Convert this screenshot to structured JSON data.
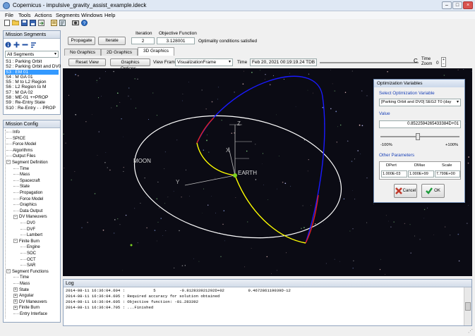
{
  "window": {
    "title": "Copernicus - impulsive_gravity_assist_example.ideck",
    "min": "–",
    "max": "□",
    "close": "×"
  },
  "menu": [
    "File",
    "Tools",
    "Actions",
    "Segments",
    "Windows",
    "Help"
  ],
  "toolbar": {
    "icons": [
      "new-file-icon",
      "open-folder-icon",
      "save-icon",
      "save-as-icon",
      "export-icon",
      "settings-icon",
      "script-icon",
      "render-icon",
      "help-icon"
    ]
  },
  "mission_segments": {
    "title": "Mission Segments",
    "filter": "All Segments",
    "items": [
      "S1 : Parking Orbit",
      "S2 : Parking Orbit and DV0",
      "S3 : EM 01",
      "S4 : M GA 01",
      "S5 : M to L2 Region",
      "S6 : L2 Region to M",
      "S7 : M GA 02",
      "S8 : ME-01 ++PROP",
      "S9 : Re-Entry State",
      "S10 : Re-Entry - - PROP"
    ],
    "selected_index": 2
  },
  "mission_config": {
    "title": "Mission Config",
    "tree": [
      {
        "label": "Info",
        "level": 0,
        "expander": ""
      },
      {
        "label": "SPICE",
        "level": 0,
        "expander": ""
      },
      {
        "label": "Force Model",
        "level": 0,
        "expander": ""
      },
      {
        "label": "Algorithms",
        "level": 0,
        "expander": ""
      },
      {
        "label": "Output Files",
        "level": 0,
        "expander": ""
      },
      {
        "label": "Segment Definition",
        "level": 0,
        "expander": "−"
      },
      {
        "label": "Time",
        "level": 1,
        "expander": ""
      },
      {
        "label": "Mass",
        "level": 1,
        "expander": ""
      },
      {
        "label": "Spacecraft",
        "level": 1,
        "expander": ""
      },
      {
        "label": "State",
        "level": 1,
        "expander": ""
      },
      {
        "label": "Propagation",
        "level": 1,
        "expander": ""
      },
      {
        "label": "Force Model",
        "level": 1,
        "expander": ""
      },
      {
        "label": "Graphics",
        "level": 1,
        "expander": ""
      },
      {
        "label": "Data Output",
        "level": 1,
        "expander": ""
      },
      {
        "label": "DV Maneuvers",
        "level": 1,
        "expander": "−"
      },
      {
        "label": "DV0",
        "level": 2,
        "expander": ""
      },
      {
        "label": "DVF",
        "level": 2,
        "expander": ""
      },
      {
        "label": "Lambert",
        "level": 2,
        "expander": ""
      },
      {
        "label": "Finite Burn",
        "level": 1,
        "expander": "−"
      },
      {
        "label": "Engine",
        "level": 2,
        "expander": ""
      },
      {
        "label": "SOC",
        "level": 2,
        "expander": ""
      },
      {
        "label": "OCT",
        "level": 2,
        "expander": ""
      },
      {
        "label": "SAR",
        "level": 2,
        "expander": ""
      },
      {
        "label": "Segment Functions",
        "level": 0,
        "expander": "−"
      },
      {
        "label": "Time",
        "level": 1,
        "expander": ""
      },
      {
        "label": "Mass",
        "level": 1,
        "expander": ""
      },
      {
        "label": "State",
        "level": 1,
        "expander": "+"
      },
      {
        "label": "Angular",
        "level": 1,
        "expander": "+"
      },
      {
        "label": "DV Maneuvers",
        "level": 1,
        "expander": "+"
      },
      {
        "label": "Finite Burn",
        "level": 1,
        "expander": "+"
      },
      {
        "label": "Entry Interface",
        "level": 1,
        "expander": ""
      }
    ]
  },
  "actions": {
    "propagate": "Propagate",
    "iterate": "Iterate",
    "iteration_label": "Iteration",
    "iteration_value": "2",
    "objective_label": "Objective Function",
    "objective_value": "3.128001",
    "status": "Optimality conditions satisfied"
  },
  "tabs": [
    "No Graphics",
    "2D Graphics",
    "3D Graphics"
  ],
  "active_tab": 2,
  "view_controls": {
    "reset_view": "Reset View",
    "graphics_options": "Graphics Options...",
    "view_frame_label": "View Frame",
    "view_frame_value": "VisualizationFrame",
    "time_label": "Time",
    "time_value": "Feb 20, 2021  00:19:19.24 TDB",
    "slider_end": "C",
    "time_zoom_label_1": "Time",
    "time_zoom_label_2": "Zoom",
    "time_zoom_value": "0"
  },
  "scene": {
    "labels": {
      "moon": "MOON",
      "earth": "EARTH",
      "axis_x": "X",
      "axis_y": "Y",
      "axis_z": "Z"
    },
    "colors": {
      "background": "#0b0b14",
      "orbit": "#ffffff",
      "transfer": "#ffff00",
      "outbound": "#0000ff",
      "burn": "#ff0000",
      "earth": "#7ed321"
    }
  },
  "optimization": {
    "title": "Optimization Variables",
    "select_label": "Select Optimization Variable",
    "selected_variable": "[Parking Orbit and DV0] SEG2 T0 (day",
    "value_label": "Value",
    "value": "0.8522594265433384D+01",
    "slider_min": "-100%",
    "slider_max": "+100%",
    "other_params_label": "Other Parameters",
    "param_headers": [
      "DPert",
      "DMax",
      "Scale"
    ],
    "param_values": [
      "1.000E-03",
      "1.000E+99",
      "7.799E+00"
    ],
    "cancel": "Cancel",
    "ok": "OK"
  },
  "log": {
    "title": "Log",
    "lines": [
      "2014-08-11 16:36:04.604 :            5          -0.812833921292D+02          0.467286119039D-12",
      "2014-08-11 16:36:04.605 : Required accuracy for solution obtained",
      "2014-08-11 16:36:04.605 : Objective function: -81.283392",
      "2014-08-11 16:36:04.705 : ...Finished"
    ]
  }
}
